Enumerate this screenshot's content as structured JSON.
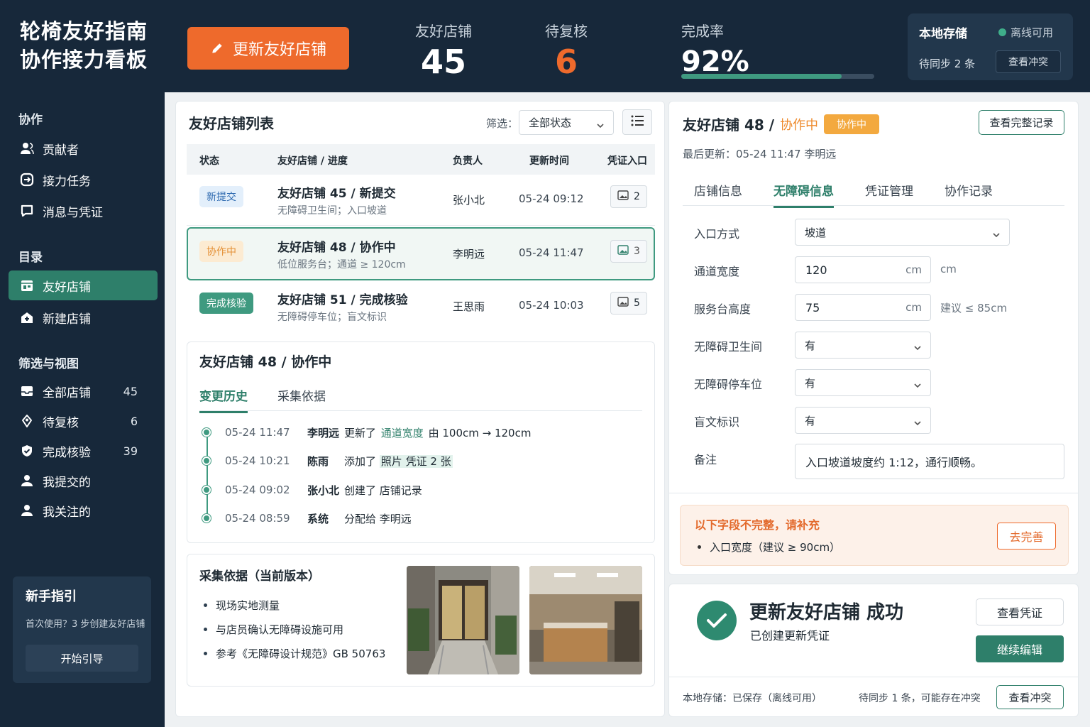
{
  "header": {
    "title_line1": "轮椅友好指南",
    "title_line2": "协作接力看板",
    "cta_label": "更新友好店铺",
    "stats": [
      {
        "label": "友好店铺",
        "value": "45"
      },
      {
        "label": "待复核",
        "value": "6"
      },
      {
        "label": "完成率",
        "value": "92%"
      }
    ],
    "completion_fraction": 0.83,
    "storage": {
      "title": "本地存储",
      "status": "离线可用",
      "pending": "待同步 2 条",
      "button": "查看冲突"
    }
  },
  "sidebar": {
    "sections": [
      "协作",
      "目录",
      "筛选与视图"
    ],
    "collab": [
      "贡献者",
      "接力任务",
      "消息与凭证"
    ],
    "catalog": [
      "友好店铺",
      "新建店铺"
    ],
    "views": [
      {
        "label": "全部店铺",
        "count": "45"
      },
      {
        "label": "待复核",
        "count": "6"
      },
      {
        "label": "完成核验",
        "count": "39"
      },
      {
        "label": "我提交的",
        "count": ""
      },
      {
        "label": "我关注的",
        "count": ""
      }
    ],
    "guide": {
      "title": "新手指引",
      "desc": "首次使用？3 步创建友好店铺",
      "button": "开始引导"
    }
  },
  "list": {
    "title": "友好店铺列表",
    "filter_label": "筛选：",
    "filter_value": "全部状态",
    "columns": [
      "状态",
      "友好店铺 / 进度",
      "负责人",
      "更新时间",
      "凭证入口"
    ],
    "rows": [
      {
        "status": "新提交",
        "name": "友好店铺 45 / 新提交",
        "sub": "无障碍卫生间；入口坡道",
        "owner": "张小北",
        "time": "05-24 09:12",
        "evidence": "2"
      },
      {
        "status": "协作中",
        "name": "友好店铺 48 / 协作中",
        "sub": "低位服务台；通道 ≥ 120cm",
        "owner": "李明远",
        "time": "05-24 11:47",
        "evidence": "3"
      },
      {
        "status": "完成核验",
        "name": "友好店铺 51 / 完成核验",
        "sub": "无障碍停车位；盲文标识",
        "owner": "王思雨",
        "time": "05-24 10:03",
        "evidence": "5"
      }
    ]
  },
  "history": {
    "title": "友好店铺 48 / 协作中",
    "tabs": [
      "变更历史",
      "采集依据"
    ],
    "items": [
      {
        "time": "05-24 11:47",
        "who": "李明远",
        "pre": "更新了",
        "hl": "通道宽度",
        "post": "由 100cm → 120cm"
      },
      {
        "time": "05-24 10:21",
        "who": "陈雨",
        "pre": "添加了",
        "hl": "照片 凭证 2 张",
        "post": ""
      },
      {
        "time": "05-24 09:02",
        "who": "张小北",
        "pre": "创建了 店铺记录",
        "hl": "",
        "post": ""
      },
      {
        "time": "05-24 08:59",
        "who": "系统",
        "pre": "分配给 李明远",
        "hl": "",
        "post": ""
      }
    ]
  },
  "basis": {
    "title": "采集依据（当前版本）",
    "items": [
      "现场实地测量",
      "与店员确认无障碍设施可用",
      "参考《无障碍设计规范》GB 50763"
    ]
  },
  "detail": {
    "name": "友好店铺 48 /",
    "status_text": "协作中",
    "pill": "协作中",
    "full_record": "查看完整记录",
    "meta": "最后更新：05-24 11:47    李明远",
    "tabs": [
      "店铺信息",
      "无障碍信息",
      "凭证管理",
      "协作记录"
    ],
    "fields": [
      {
        "label": "入口方式",
        "value": "坡道",
        "unit": "",
        "aside": ""
      },
      {
        "label": "通道宽度",
        "value": "120",
        "unit": "cm",
        "aside": "cm"
      },
      {
        "label": "服务台高度",
        "value": "75",
        "unit": "cm",
        "aside": "建议 ≤ 85cm"
      },
      {
        "label": "无障碍卫生间",
        "value": "有",
        "unit": "",
        "aside": ""
      },
      {
        "label": "无障碍停车位",
        "value": "有",
        "unit": "",
        "aside": ""
      },
      {
        "label": "盲文标识",
        "value": "有",
        "unit": "",
        "aside": ""
      },
      {
        "label": "备注",
        "value": "入口坡道坡度约 1:12，通行顺畅。",
        "unit": "",
        "aside": ""
      }
    ]
  },
  "warning": {
    "title": "以下字段不完整，请补充",
    "item": "入口宽度（建议 ≥ 90cm）",
    "button": "去完善"
  },
  "success": {
    "title": "更新友好店铺 成功",
    "sub": "已创建更新凭证",
    "view_button": "查看凭证",
    "continue_button": "继续编辑",
    "footer_left": "本地存储：已保存（离线可用）",
    "footer_mid": "待同步 1 条，可能存在冲突",
    "footer_button": "查看冲突"
  },
  "colors": {
    "accent": "#2e7f6a",
    "orange": "#ee6a2c",
    "navy": "#17283a"
  }
}
